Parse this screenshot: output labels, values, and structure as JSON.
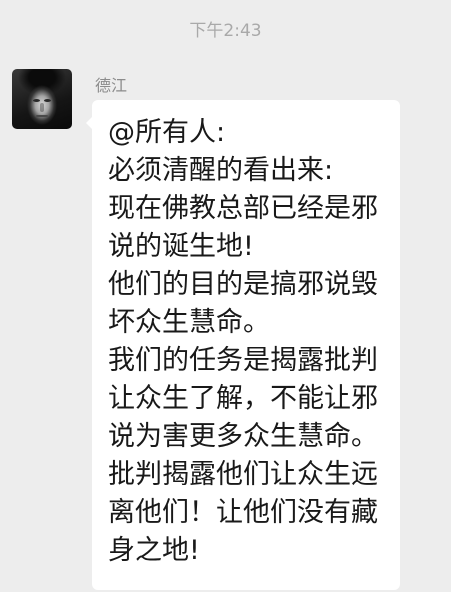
{
  "colors": {
    "background": "#ededed",
    "bubble": "#ffffff",
    "text": "#191919",
    "meta_text": "#a9a9a9"
  },
  "chat": {
    "timestamp": "下午2:43",
    "message": {
      "sender": "德江",
      "avatar_icon": "portrait-photo",
      "lines": [
        "@所有人:",
        "必须清醒的看出来:",
        "现在佛教总部已经是邪",
        "说的诞生地!",
        "他们的目的是搞邪说毁",
        "坏众生慧命。",
        "我们的任务是揭露批判",
        "让众生了解，不能让邪",
        "说为害更多众生慧命。",
        "批判揭露他们让众生远",
        "离他们！让他们没有藏",
        "身之地!"
      ]
    }
  }
}
